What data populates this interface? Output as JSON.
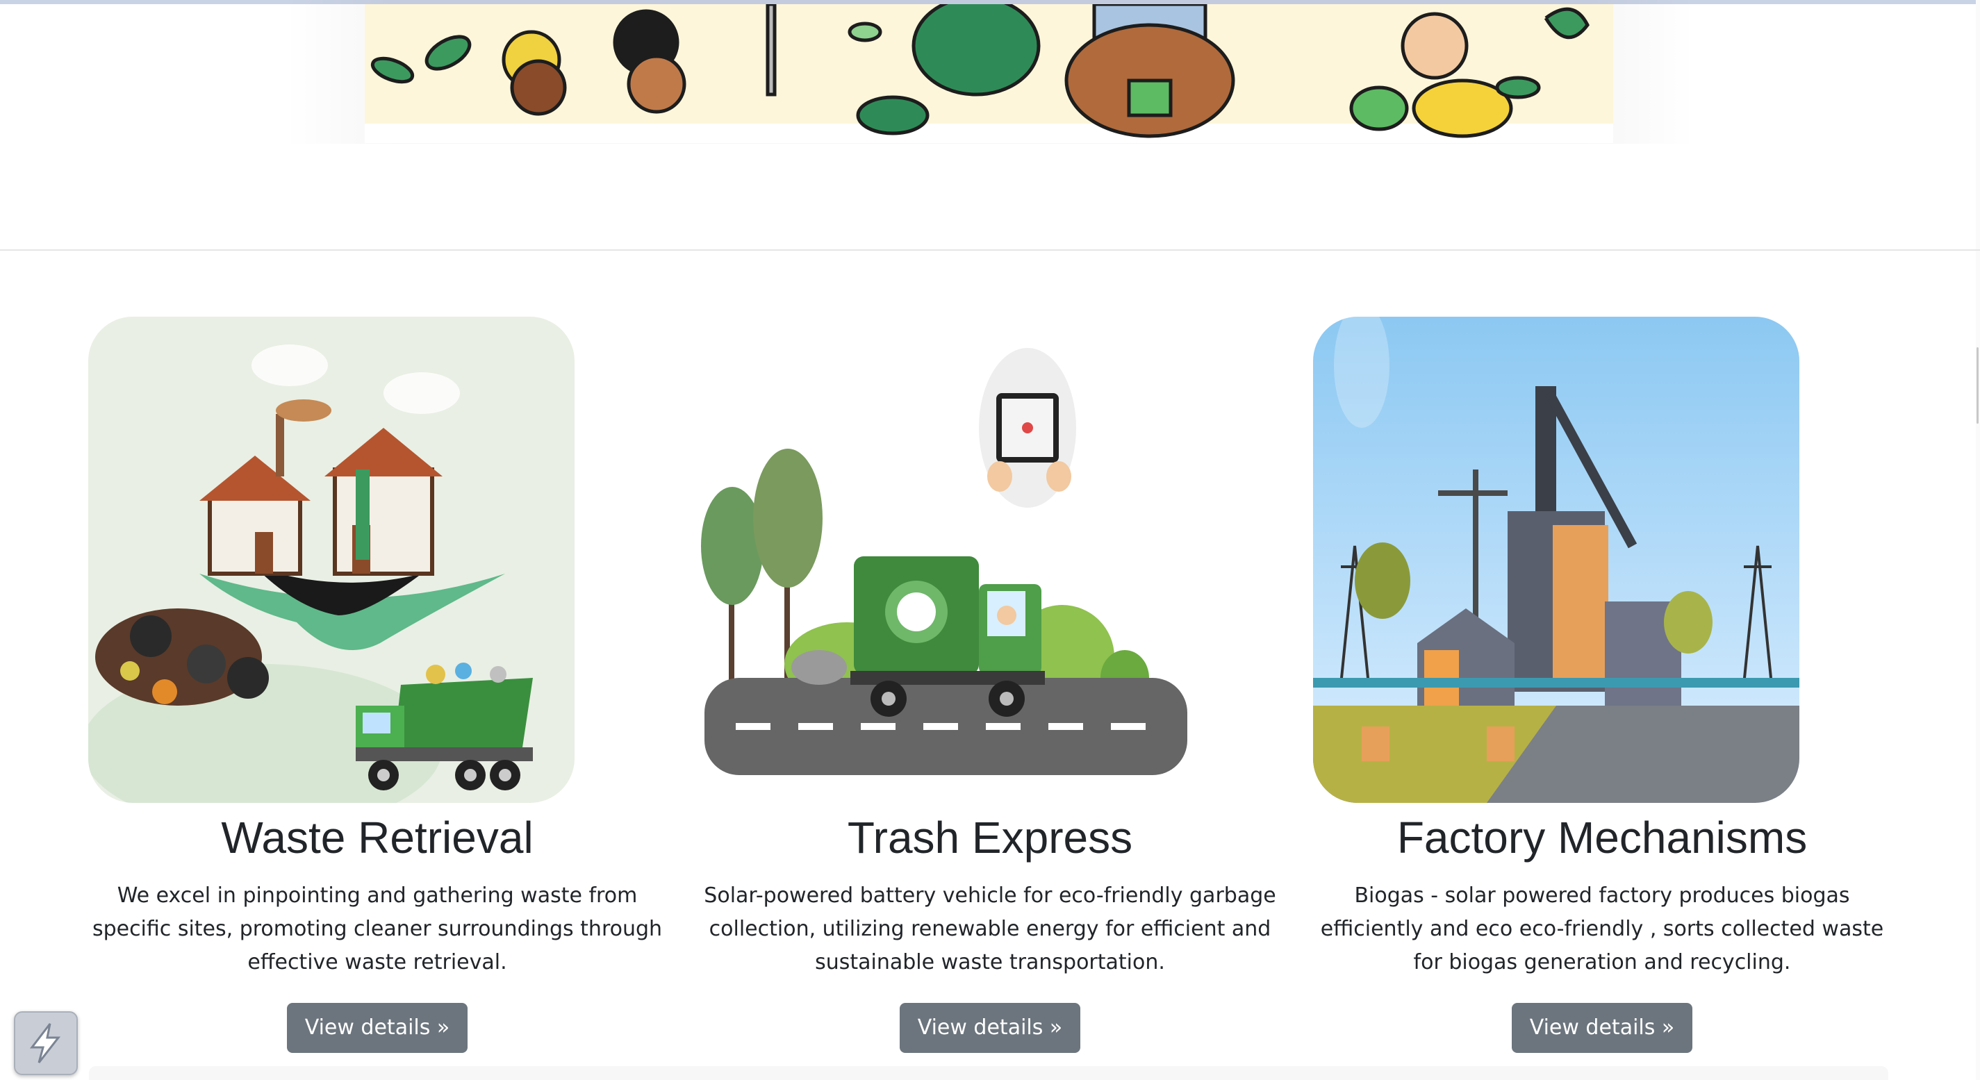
{
  "features": [
    {
      "title": "Waste Retrieval",
      "description": "We excel in pinpointing and gathering waste from specific sites, promoting cleaner surroundings through effective waste retrieval.",
      "button_label": "View details »"
    },
    {
      "title": "Trash Express",
      "description": "Solar-powered battery vehicle for eco-friendly garbage collection, utilizing renewable energy for efficient and sustainable waste transportation.",
      "button_label": "View details »"
    },
    {
      "title": "Factory Mechanisms",
      "description": "Biogas - solar powered factory produces biogas efficiently and eco eco-friendly , sorts collected waste for biogas generation and recycling.",
      "button_label": "View details »"
    }
  ],
  "icons": {
    "launcher": "lightning-bolt-icon"
  },
  "colors": {
    "button_bg": "#6c757d",
    "banner_bg": "#fdf6da",
    "leaf_green": "#2e8b57"
  }
}
